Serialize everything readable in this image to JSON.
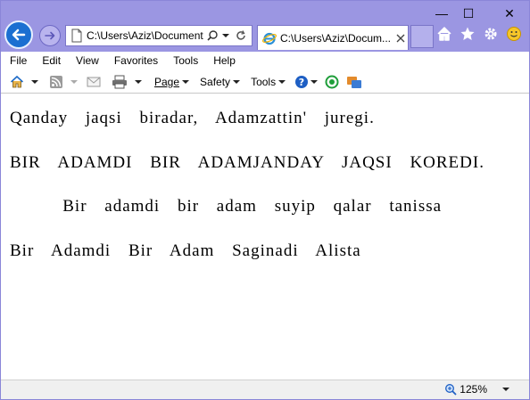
{
  "window": {
    "controls": {
      "minimize": "—",
      "maximize": "☐",
      "close": "✕"
    }
  },
  "nav": {
    "address": "C:\\Users\\Aziz\\Document",
    "tab_title": "C:\\Users\\Aziz\\Docum..."
  },
  "menubar": {
    "items": [
      "File",
      "Edit",
      "View",
      "Favorites",
      "Tools",
      "Help"
    ]
  },
  "commandbar": {
    "page_label": "Page",
    "safety_label": "Safety",
    "tools_label": "Tools"
  },
  "content": {
    "lines": [
      "Qanday jaqsi biradar, Adamzattin' juregi.",
      "BIR ADAMDI BIR ADAMJANDAY JAQSI KOREDI.",
      "   Bir adamdi bir adam suyip qalar tanissa",
      "Bir Adamdi Bir Adam Saginadi Alista"
    ]
  },
  "status": {
    "zoom": "125%"
  },
  "colors": {
    "titlebar": "#9b96e2",
    "back_button": "#1b6fd1"
  }
}
